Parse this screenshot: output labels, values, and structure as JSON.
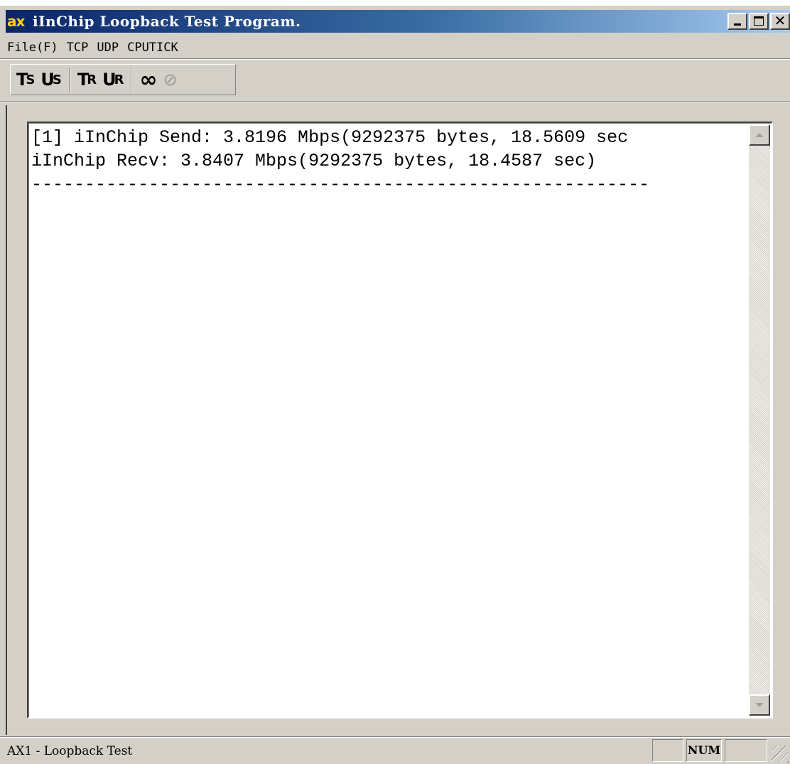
{
  "window": {
    "title": "iInChip Loopback Test Program.",
    "icon_label": "ax",
    "caption_buttons": {
      "minimize": "minimize-icon",
      "maximize": "maximize-icon",
      "close": "✕"
    }
  },
  "menu": {
    "items": [
      {
        "label": "File(F)"
      },
      {
        "label": "TCP"
      },
      {
        "label": "UDP"
      },
      {
        "label": "CPUTICK"
      }
    ]
  },
  "toolbar": {
    "tcp_send": {
      "main": "T",
      "sub": "S"
    },
    "udp_send": {
      "main": "U",
      "sub": "S"
    },
    "tcp_recv": {
      "main": "T",
      "sub": "R"
    },
    "udp_recv": {
      "main": "U",
      "sub": "R"
    },
    "loop": "∞",
    "stop": "⊘"
  },
  "output": {
    "lines": [
      "[1] iInChip Send: 3.8196 Mbps(9292375 bytes, 18.5609 sec",
      "iInChip Recv: 3.8407 Mbps(9292375 bytes, 18.4587 sec)",
      "----------------------------------------------------------"
    ]
  },
  "status": {
    "text": "AX1 - Loopback Test",
    "indicators": [
      "",
      "NUM",
      ""
    ]
  },
  "colors": {
    "title_gradient_start": "#0a246a",
    "title_gradient_end": "#a6caf0",
    "window_face": "#d4d0c8",
    "icon_accent": "#ffd400"
  }
}
